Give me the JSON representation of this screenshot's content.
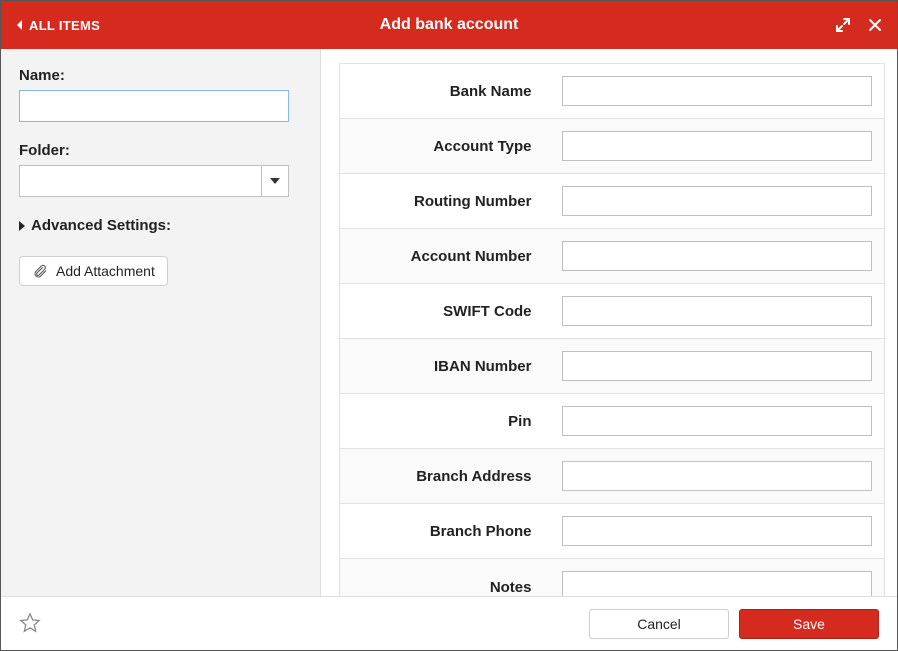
{
  "colors": {
    "accent": "#d52b1e"
  },
  "header": {
    "back_label": "ALL ITEMS",
    "title": "Add bank account"
  },
  "sidebar": {
    "name_label": "Name:",
    "name_value": "",
    "folder_label": "Folder:",
    "folder_value": "",
    "advanced_label": "Advanced Settings:",
    "add_attachment_label": "Add Attachment"
  },
  "fields": [
    {
      "label": "Bank Name",
      "value": "",
      "type": "text"
    },
    {
      "label": "Account Type",
      "value": "",
      "type": "text"
    },
    {
      "label": "Routing Number",
      "value": "",
      "type": "text"
    },
    {
      "label": "Account Number",
      "value": "",
      "type": "text"
    },
    {
      "label": "SWIFT Code",
      "value": "",
      "type": "text"
    },
    {
      "label": "IBAN Number",
      "value": "",
      "type": "text"
    },
    {
      "label": "Pin",
      "value": "",
      "type": "text"
    },
    {
      "label": "Branch Address",
      "value": "",
      "type": "text"
    },
    {
      "label": "Branch Phone",
      "value": "",
      "type": "text"
    },
    {
      "label": "Notes",
      "value": "",
      "type": "textarea"
    }
  ],
  "footer": {
    "cancel_label": "Cancel",
    "save_label": "Save"
  }
}
